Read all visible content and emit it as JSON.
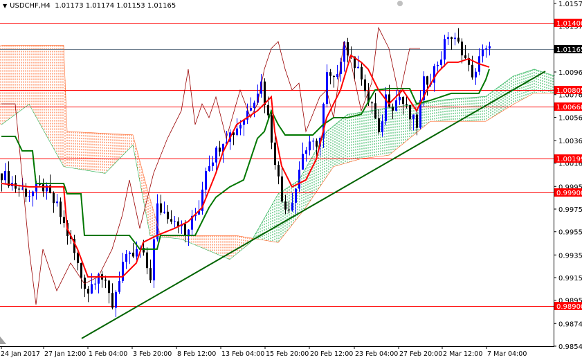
{
  "header": {
    "symbol": "USDCHF,H4",
    "open": "1.01173",
    "high": "1.01174",
    "low": "1.01153",
    "close": "1.01165",
    "menu_icon": "triangle-down-icon"
  },
  "chart_data": {
    "type": "candlestick",
    "title": "USDCHF,H4",
    "ylim": [
      0.98545,
      1.0157
    ],
    "y_ticks": [
      "1.01570",
      "1.01370",
      "1.00965",
      "1.00765",
      "1.00565",
      "1.00360",
      "1.00160",
      "0.99955",
      "0.99755",
      "0.99555",
      "0.99350",
      "0.99150",
      "0.98950",
      "0.98745",
      "0.98545"
    ],
    "x_ticks": [
      {
        "bar": 0,
        "label": "24 Jan 2017"
      },
      {
        "bar": 12.2,
        "label": "27 Jan 12:00"
      },
      {
        "bar": 25,
        "label": "1 Feb 04:00"
      },
      {
        "bar": 37.8,
        "label": "3 Feb 20:00"
      },
      {
        "bar": 50.6,
        "label": "8 Feb 12:00"
      },
      {
        "bar": 63.4,
        "label": "13 Feb 04:00"
      },
      {
        "bar": 76.2,
        "label": "15 Feb 20:00"
      },
      {
        "bar": 89,
        "label": "20 Feb 12:00"
      },
      {
        "bar": 102,
        "label": "23 Feb 04:00"
      },
      {
        "bar": 114.8,
        "label": "27 Feb 20:00"
      },
      {
        "bar": 127.4,
        "label": "2 Mar 12:00"
      },
      {
        "bar": 140.2,
        "label": "7 Mar 04:00"
      }
    ],
    "levels": [
      {
        "price": 1.014,
        "label": "1.01400",
        "color": "#ff0000"
      },
      {
        "price": 1.00805,
        "label": "1.00805",
        "color": "#ff0000"
      },
      {
        "price": 1.0066,
        "label": "1.00660",
        "color": "#ff0000"
      },
      {
        "price": 1.00199,
        "label": "1.00199",
        "color": "#ff0000"
      },
      {
        "price": 0.999,
        "label": "0.99900",
        "color": "#ff0000"
      },
      {
        "price": 0.989,
        "label": "0.98900",
        "color": "#ff0000"
      }
    ],
    "current_price": {
      "price": 1.01165,
      "label": "1.01165",
      "color": "#000000",
      "line_color": "#708090"
    },
    "colors": {
      "up": "#0000ff",
      "down": "#000000",
      "tenkan": "#ff0000",
      "kijun": "#007700",
      "chikou": "#990000",
      "cloud_bear": "#ff6020",
      "cloud_bull": "#20b050",
      "trendline": "#006400"
    },
    "trendline": [
      [
        23.2,
        0.98613
      ],
      [
        157.2,
        1.00971
      ]
    ],
    "closes": [
      [
        0,
        1.0007
      ],
      [
        4,
        0.9995
      ],
      [
        8,
        0.9989
      ],
      [
        12,
        0.9995
      ],
      [
        16,
        0.9977
      ],
      [
        20,
        0.9946
      ],
      [
        23,
        0.9916
      ],
      [
        25,
        0.9903
      ],
      [
        28,
        0.9922
      ],
      [
        32,
        0.9891
      ],
      [
        35,
        0.9928
      ],
      [
        38,
        0.9934
      ],
      [
        40,
        0.994
      ],
      [
        43,
        0.9916
      ],
      [
        45,
        0.9977
      ],
      [
        48,
        0.9971
      ],
      [
        51,
        0.9965
      ],
      [
        53,
        0.9952
      ],
      [
        55,
        0.9965
      ],
      [
        57,
        0.9977
      ],
      [
        59,
        1.0013
      ],
      [
        62,
        1.0026
      ],
      [
        64,
        1.0038
      ],
      [
        67,
        1.0044
      ],
      [
        70,
        1.0056
      ],
      [
        73,
        1.0075
      ],
      [
        75,
        1.0087
      ],
      [
        77,
        1.0056
      ],
      [
        79,
        1.002
      ],
      [
        81,
        0.9983
      ],
      [
        83,
        0.9977
      ],
      [
        85,
        0.9995
      ],
      [
        87,
        1.0026
      ],
      [
        90,
        1.0032
      ],
      [
        92,
        1.0038
      ],
      [
        94,
        1.0093
      ],
      [
        96,
        1.0087
      ],
      [
        99,
        1.0123
      ],
      [
        101,
        1.0105
      ],
      [
        103,
        1.0105
      ],
      [
        105,
        1.0075
      ],
      [
        107,
        1.0068
      ],
      [
        109,
        1.0038
      ],
      [
        111,
        1.0075
      ],
      [
        113,
        1.0068
      ],
      [
        115,
        1.0075
      ],
      [
        118,
        1.0056
      ],
      [
        120,
        1.005
      ],
      [
        122,
        1.0087
      ],
      [
        124,
        1.0093
      ],
      [
        127,
        1.0111
      ],
      [
        129,
        1.013
      ],
      [
        131,
        1.0123
      ],
      [
        133,
        1.0117
      ],
      [
        135,
        1.0099
      ],
      [
        137,
        1.0093
      ],
      [
        139,
        1.012
      ],
      [
        141,
        1.0116
      ]
    ],
    "tenkan": [
      [
        0,
        0.99981
      ],
      [
        8,
        0.99951
      ],
      [
        18,
        0.99951
      ],
      [
        19,
        0.99584
      ],
      [
        22,
        0.99401
      ],
      [
        25,
        0.99157
      ],
      [
        35,
        0.99157
      ],
      [
        39,
        0.99279
      ],
      [
        41,
        0.99462
      ],
      [
        45,
        0.99523
      ],
      [
        50,
        0.99584
      ],
      [
        54,
        0.99645
      ],
      [
        58,
        0.99768
      ],
      [
        62,
        1.00073
      ],
      [
        64,
        1.00256
      ],
      [
        68,
        1.00501
      ],
      [
        74,
        1.00623
      ],
      [
        78,
        1.00745
      ],
      [
        79,
        1.0044
      ],
      [
        81,
        1.00134
      ],
      [
        84,
        0.99951
      ],
      [
        88,
        1.00012
      ],
      [
        91,
        1.00195
      ],
      [
        94,
        1.00562
      ],
      [
        98,
        1.00806
      ],
      [
        101,
        1.01112
      ],
      [
        104,
        1.01051
      ],
      [
        106,
        1.0099
      ],
      [
        109,
        1.00806
      ],
      [
        112,
        1.00684
      ],
      [
        116,
        1.00806
      ],
      [
        120,
        1.00623
      ],
      [
        123,
        1.00806
      ],
      [
        126,
        1.00959
      ],
      [
        129,
        1.01051
      ],
      [
        132,
        1.01051
      ],
      [
        135,
        1.01081
      ],
      [
        138,
        1.01038
      ],
      [
        141,
        1.01008
      ]
    ],
    "kijun": [
      [
        0,
        1.00397
      ],
      [
        4,
        1.00397
      ],
      [
        6,
        1.00269
      ],
      [
        9,
        1.00269
      ],
      [
        10,
        0.99981
      ],
      [
        18,
        0.99981
      ],
      [
        19,
        0.9989
      ],
      [
        23,
        0.9989
      ],
      [
        24,
        0.99523
      ],
      [
        37,
        0.99523
      ],
      [
        40,
        0.99401
      ],
      [
        45,
        0.99401
      ],
      [
        46,
        0.99523
      ],
      [
        56,
        0.99523
      ],
      [
        58,
        0.99645
      ],
      [
        60,
        0.99768
      ],
      [
        62,
        0.99859
      ],
      [
        66,
        0.99951
      ],
      [
        70,
        1.00012
      ],
      [
        74,
        1.00379
      ],
      [
        76,
        1.0044
      ],
      [
        78,
        1.00623
      ],
      [
        80,
        1.00501
      ],
      [
        82,
        1.00409
      ],
      [
        90,
        1.00409
      ],
      [
        93,
        1.00501
      ],
      [
        96,
        1.00562
      ],
      [
        100,
        1.00562
      ],
      [
        104,
        1.00592
      ],
      [
        108,
        1.00806
      ],
      [
        112,
        1.00818
      ],
      [
        118,
        1.00818
      ],
      [
        120,
        1.00684
      ],
      [
        124,
        1.00715
      ],
      [
        130,
        1.00776
      ],
      [
        138,
        1.00776
      ],
      [
        140,
        1.00898
      ],
      [
        141,
        1.0099
      ]
    ],
    "chikou": [
      [
        0,
        1.00684
      ],
      [
        4,
        1.00684
      ],
      [
        8,
        0.99401
      ],
      [
        10,
        0.98912
      ],
      [
        12,
        0.99401
      ],
      [
        16,
        0.99034
      ],
      [
        20,
        0.99279
      ],
      [
        24,
        0.99096
      ],
      [
        28,
        0.99157
      ],
      [
        32,
        0.99401
      ],
      [
        35,
        0.99706
      ],
      [
        37,
        1.00012
      ],
      [
        40,
        0.99584
      ],
      [
        44,
        1.00073
      ],
      [
        48,
        1.00379
      ],
      [
        52,
        1.00623
      ],
      [
        54,
        1.0099
      ],
      [
        56,
        1.00501
      ],
      [
        58,
        1.00684
      ],
      [
        60,
        1.00562
      ],
      [
        62,
        1.00745
      ],
      [
        65,
        1.00379
      ],
      [
        69,
        1.00806
      ],
      [
        72,
        1.00562
      ],
      [
        74,
        1.00684
      ],
      [
        76,
        1.0099
      ],
      [
        78,
        1.01173
      ],
      [
        80,
        1.01234
      ],
      [
        82,
        1.0099
      ],
      [
        84,
        1.00806
      ],
      [
        86,
        1.00867
      ],
      [
        88,
        1.0044
      ],
      [
        92,
        1.00745
      ],
      [
        94,
        1.00806
      ],
      [
        96,
        1.00562
      ],
      [
        99,
        1.01234
      ],
      [
        101,
        1.01051
      ],
      [
        104,
        1.00623
      ],
      [
        107,
        1.00867
      ],
      [
        109,
        1.01356
      ],
      [
        112,
        1.01173
      ],
      [
        115,
        1.00745
      ],
      [
        118,
        1.01173
      ],
      [
        121,
        1.01173
      ]
    ],
    "span_a": [
      [
        0,
        1.005
      ],
      [
        8,
        1.0068
      ],
      [
        18,
        1.0013
      ],
      [
        30,
        1.0007
      ],
      [
        38,
        1.0032
      ],
      [
        43,
        0.9952
      ],
      [
        52,
        0.9949
      ],
      [
        66,
        0.9931
      ],
      [
        72,
        0.9946
      ],
      [
        80,
        0.9989
      ],
      [
        86,
        1.0001
      ],
      [
        94,
        1.0044
      ],
      [
        100,
        1.0059
      ],
      [
        112,
        1.0065
      ],
      [
        120,
        1.0068
      ],
      [
        128,
        1.0072
      ],
      [
        140,
        1.0075
      ],
      [
        148,
        1.0093
      ],
      [
        154,
        1.0099
      ],
      [
        160,
        1.0093
      ]
    ],
    "span_b": [
      [
        0,
        1.012
      ],
      [
        18,
        1.012
      ],
      [
        19,
        1.0044
      ],
      [
        38,
        1.0041
      ],
      [
        42,
        0.9995
      ],
      [
        46,
        0.9952
      ],
      [
        68,
        0.9952
      ],
      [
        80,
        0.9946
      ],
      [
        88,
        0.9977
      ],
      [
        96,
        1.0013
      ],
      [
        104,
        1.002
      ],
      [
        112,
        1.0023
      ],
      [
        118,
        1.0038
      ],
      [
        124,
        1.0053
      ],
      [
        140,
        1.0053
      ],
      [
        148,
        1.0068
      ],
      [
        154,
        1.0078
      ],
      [
        160,
        1.0078
      ]
    ]
  }
}
